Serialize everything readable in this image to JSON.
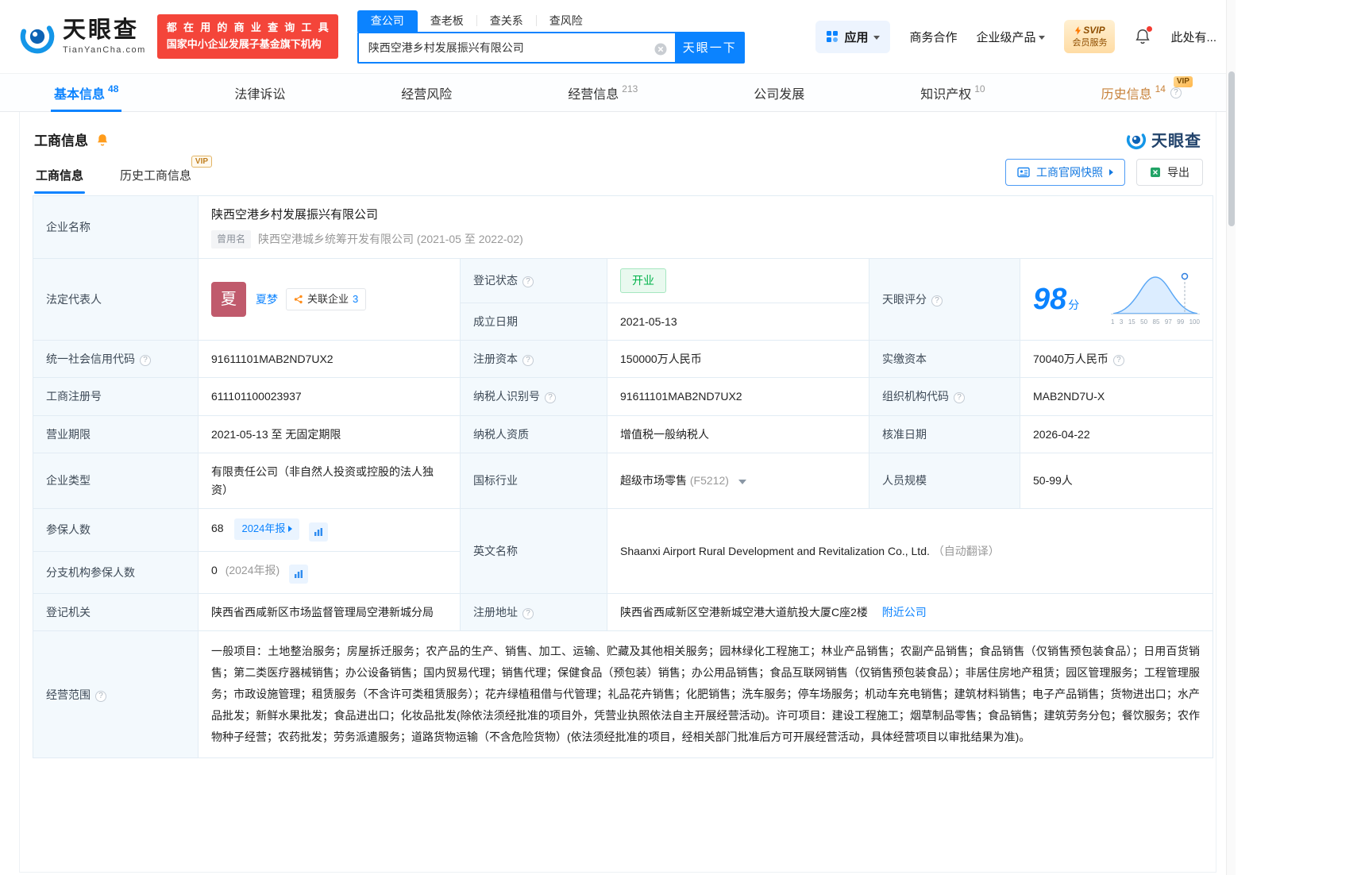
{
  "icons": {
    "help": "?"
  },
  "header": {
    "brand": "天眼查",
    "brand_domain": "TianYanCha.com",
    "promo_line1": "都在用的商业查询工具",
    "promo_line2": "国家中小企业发展子基金旗下机构",
    "tab_company": "查公司",
    "tab_boss": "查老板",
    "tab_relation": "查关系",
    "tab_risk": "查风险",
    "search_value": "陕西空港乡村发展振兴有限公司",
    "search_button": "天眼一下",
    "apps_label": "应用",
    "cooperation": "商务合作",
    "enterprise_products": "企业级产品",
    "svip_line1": "SVIP",
    "svip_line2": "会员服务",
    "user_label": "此处有..."
  },
  "nav": {
    "basic": "基本信息",
    "basic_count": "48",
    "legal": "法律诉讼",
    "operating_risk": "经营风险",
    "business_info": "经营信息",
    "business_info_count": "213",
    "development": "公司发展",
    "intellectual_property": "知识产权",
    "ip_count": "10",
    "history": "历史信息",
    "history_count": "14",
    "history_vip": "VIP"
  },
  "section": {
    "title": "工商信息",
    "watermark_brand": "天眼查",
    "tab_current": "工商信息",
    "tab_history": "历史工商信息",
    "history_vip": "VIP",
    "snapshot_button": "工商官网快照",
    "export_button": "导出"
  },
  "fields": {
    "company_name": {
      "label": "企业名称",
      "value": "陕西空港乡村发展振兴有限公司",
      "former_badge": "曾用名",
      "former_value": "陕西空港城乡统筹开发有限公司 (2021-05 至 2022-02)"
    },
    "legal_rep": {
      "label": "法定代表人",
      "avatar": "夏",
      "name": "夏梦",
      "related_label": "关联企业",
      "related_count": "3"
    },
    "reg_status": {
      "label": "登记状态",
      "value": "开业"
    },
    "score": {
      "label": "天眼评分",
      "value": "98",
      "unit": "分",
      "ticks": [
        "1",
        "3",
        "15",
        "50",
        "85",
        "97",
        "99",
        "100"
      ]
    },
    "establish_date": {
      "label": "成立日期",
      "value": "2021-05-13"
    },
    "credit_code": {
      "label": "统一社会信用代码",
      "value": "91611101MAB2ND7UX2"
    },
    "reg_capital": {
      "label": "注册资本",
      "value": "150000万人民币"
    },
    "paid_capital": {
      "label": "实缴资本",
      "value": "70040万人民币"
    },
    "reg_number": {
      "label": "工商注册号",
      "value": "611101100023937"
    },
    "taxpayer_id": {
      "label": "纳税人识别号",
      "value": "91611101MAB2ND7UX2"
    },
    "org_code": {
      "label": "组织机构代码",
      "value": "MAB2ND7U-X"
    },
    "business_term": {
      "label": "营业期限",
      "value": "2021-05-13 至 无固定期限"
    },
    "taxpayer_quality": {
      "label": "纳税人资质",
      "value": "增值税一般纳税人"
    },
    "approved_date": {
      "label": "核准日期",
      "value": "2026-04-22"
    },
    "company_type": {
      "label": "企业类型",
      "value": "有限责任公司（非自然人投资或控股的法人独资）"
    },
    "industry": {
      "label": "国标行业",
      "value": "超级市场零售",
      "code": "(F5212)"
    },
    "staff_size": {
      "label": "人员规模",
      "value": "50-99人"
    },
    "insured": {
      "label": "参保人数",
      "value": "68",
      "report": "2024年报"
    },
    "english_name": {
      "label": "英文名称",
      "value": "Shaanxi Airport Rural Development and Revitalization Co., Ltd.",
      "note": "（自动翻译）"
    },
    "branch_insured": {
      "label": "分支机构参保人数",
      "value": "0",
      "report": "(2024年报)"
    },
    "reg_authority": {
      "label": "登记机关",
      "value": "陕西省西咸新区市场监督管理局空港新城分局"
    },
    "reg_address": {
      "label": "注册地址",
      "value": "陕西省西咸新区空港新城空港大道航投大厦C座2楼",
      "nearby": "附近公司"
    },
    "business_scope": {
      "label": "经营范围",
      "value": "一般项目：土地整治服务；房屋拆迁服务；农产品的生产、销售、加工、运输、贮藏及其他相关服务；园林绿化工程施工；林业产品销售；农副产品销售；食品销售（仅销售预包装食品）；日用百货销售；第二类医疗器械销售；办公设备销售；国内贸易代理；销售代理；保健食品（预包装）销售；办公用品销售；食品互联网销售（仅销售预包装食品）；非居住房地产租赁；园区管理服务；工程管理服务；市政设施管理；租赁服务（不含许可类租赁服务）；花卉绿植租借与代管理；礼品花卉销售；化肥销售；洗车服务；停车场服务；机动车充电销售；建筑材料销售；电子产品销售；货物进出口；水产品批发；新鲜水果批发；食品进出口；化妆品批发(除依法须经批准的项目外，凭营业执照依法自主开展经营活动)。许可项目：建设工程施工；烟草制品零售；食品销售；建筑劳务分包；餐饮服务；农作物种子经营；农药批发；劳务派遣服务；道路货物运输（不含危险货物）(依法须经批准的项目，经相关部门批准后方可开展经营活动，具体经营项目以审批结果为准)。"
    }
  }
}
